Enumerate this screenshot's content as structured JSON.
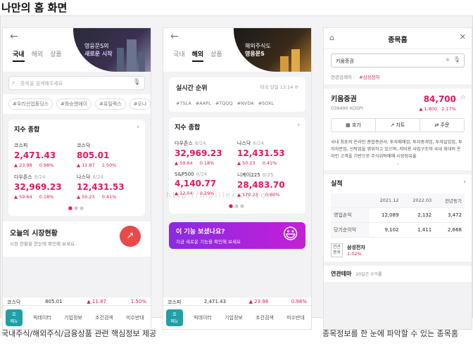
{
  "page_title": "나만의 홈 화면",
  "caption_left": "국내주식/해외주식/금융상품 관련 핵심정보 제공",
  "caption_right": "종목정보를 한 눈에 파악할 수 있는 종목홈",
  "watermark": "http://mpiller.co.com",
  "phone1": {
    "tabs": [
      "국내",
      "해외",
      "상품"
    ],
    "banner_l1": "영웅문S의",
    "banner_l2": "새로운 시작",
    "search_placeholder": "종목을 검색해주세요",
    "tags": [
      "#우리산업홀딩스",
      "#화승엔에이",
      "#유일렉스",
      "#오나"
    ],
    "index_title": "지수 종합",
    "indices": [
      {
        "name": "코스피",
        "date": "",
        "value": "2,471.43",
        "chg": "▲ 23.98",
        "pct": "0.98%"
      },
      {
        "name": "코스닥",
        "date": "",
        "value": "805.01",
        "chg": "▲ 11.87",
        "pct": "1.50%"
      },
      {
        "name": "다우존스",
        "date": "8/24",
        "value": "32,969.23",
        "chg": "▲ 59.64",
        "pct": "0.18%"
      },
      {
        "name": "나스닥",
        "date": "8/24",
        "value": "12,431.53",
        "chg": "▲ 50.23",
        "pct": "0.41%"
      }
    ],
    "market_title": "오늘의 시장현황",
    "market_sub": "시장 현황을 한눈에 확인해 보세요.",
    "ticker": {
      "name": "코스닥",
      "value": "805.01",
      "chg": "▲ 11.87",
      "pct": "1.50%"
    }
  },
  "phone2": {
    "tabs": [
      "국내",
      "해외",
      "상품"
    ],
    "banner_l1": "해외주식도",
    "banner_l2": "영웅문S",
    "rt_title": "실시간 순위",
    "rt_time": "미국 당일 13:14",
    "rt_tags": [
      "#TSLA",
      "#AAPL",
      "#TQQQ",
      "#NVDA",
      "#SOXL"
    ],
    "index_title": "지수 종합",
    "indices": [
      {
        "name": "다우존스",
        "date": "8/24",
        "value": "32,969.23",
        "chg": "▲ 59.64",
        "pct": "0.18%"
      },
      {
        "name": "나스닥",
        "date": "8/24",
        "value": "12,431.53",
        "chg": "▲ 50.23",
        "pct": "0.41%"
      },
      {
        "name": "S&P500",
        "date": "8/24",
        "value": "4,140.77",
        "chg": "▲ 12.04",
        "pct": "0.29%"
      },
      {
        "name": "니케이225",
        "date": "8/25",
        "value": "28,483.70",
        "chg": "▲ 170.23",
        "pct": "0.60%"
      }
    ],
    "promo_title": "이 기능 보셨나요?",
    "promo_sub": "지금 새로운 기능을 확인해 보세요",
    "ticker": {
      "name": "코스피",
      "value": "2,471.43",
      "chg": "▲ 23.98",
      "pct": "0.98%"
    }
  },
  "nav": {
    "menu": "메뉴",
    "items": [
      "빅데이터",
      "기업정보",
      "조건검색",
      "미수반대"
    ]
  },
  "phone3": {
    "title": "종목홈",
    "search_value": "키움증권",
    "rel_label": "연관검색어 :",
    "rel_keyword": "#삼성전자",
    "stock_name": "키움증권",
    "stock_code": "039490",
    "market": "KOSPI",
    "price": "84,700",
    "chg": "▲ 1,800",
    "pct": "2.17%",
    "buttons": [
      "호가",
      "차트",
      "주문"
    ],
    "desc": "국내 최초의 온라인 종합증권사, 투자매매업, 투자중개업, 투자일임업, 투자자문업, 신탁업을 영위하고 있으며, 저비용 사업구조와 국내 최대의 온라인 고객을 기반으로 주식위탁매매 시장점유율",
    "perf_title": "실적",
    "perf_headers": [
      "",
      "2021.12",
      "2022.03",
      "전년동기"
    ],
    "perf_rows": [
      [
        "영업손익",
        "12,089",
        "2,132",
        "3,472"
      ],
      [
        "당기순이익",
        "9,102",
        "1,411",
        "2,668"
      ]
    ],
    "theme_label1": "연관",
    "theme_label2": "종목",
    "theme_name": "삼성전자",
    "theme_pct": "1.02%",
    "rel_theme_title": "연관테마",
    "rel_theme_desc": "20일간 수익률"
  }
}
